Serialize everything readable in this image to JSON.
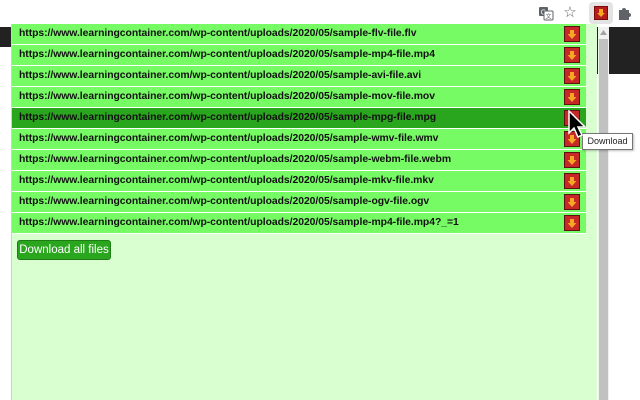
{
  "browser": {
    "toolbar_icons": [
      "translate-icon",
      "bookmark-star-icon",
      "download-extension-icon",
      "extensions-puzzle-icon"
    ],
    "star_glyph": "☆"
  },
  "popup": {
    "files": [
      {
        "url": "https://www.learningcontainer.com/wp-content/uploads/2020/05/sample-flv-file.flv"
      },
      {
        "url": "https://www.learningcontainer.com/wp-content/uploads/2020/05/sample-mp4-file.mp4"
      },
      {
        "url": "https://www.learningcontainer.com/wp-content/uploads/2020/05/sample-avi-file.avi"
      },
      {
        "url": "https://www.learningcontainer.com/wp-content/uploads/2020/05/sample-mov-file.mov"
      },
      {
        "url": "https://www.learningcontainer.com/wp-content/uploads/2020/05/sample-mpg-file.mpg"
      },
      {
        "url": "https://www.learningcontainer.com/wp-content/uploads/2020/05/sample-wmv-file.wmv"
      },
      {
        "url": "https://www.learningcontainer.com/wp-content/uploads/2020/05/sample-webm-file.webm"
      },
      {
        "url": "https://www.learningcontainer.com/wp-content/uploads/2020/05/sample-mkv-file.mkv"
      },
      {
        "url": "https://www.learningcontainer.com/wp-content/uploads/2020/05/sample-ogv-file.ogv"
      },
      {
        "url": "https://www.learningcontainer.com/wp-content/uploads/2020/05/sample-mp4-file.mp4?_=1"
      }
    ],
    "hovered_row_index": 4,
    "download_all_label": "Download all files",
    "tooltip_text": "Download"
  },
  "colors": {
    "row_bg": "#77fb65",
    "row_active_bg": "#2aa51e",
    "popup_bg": "#d9ffd0",
    "download_icon_bg": "#c62828",
    "download_arrow": "#f5a623"
  }
}
